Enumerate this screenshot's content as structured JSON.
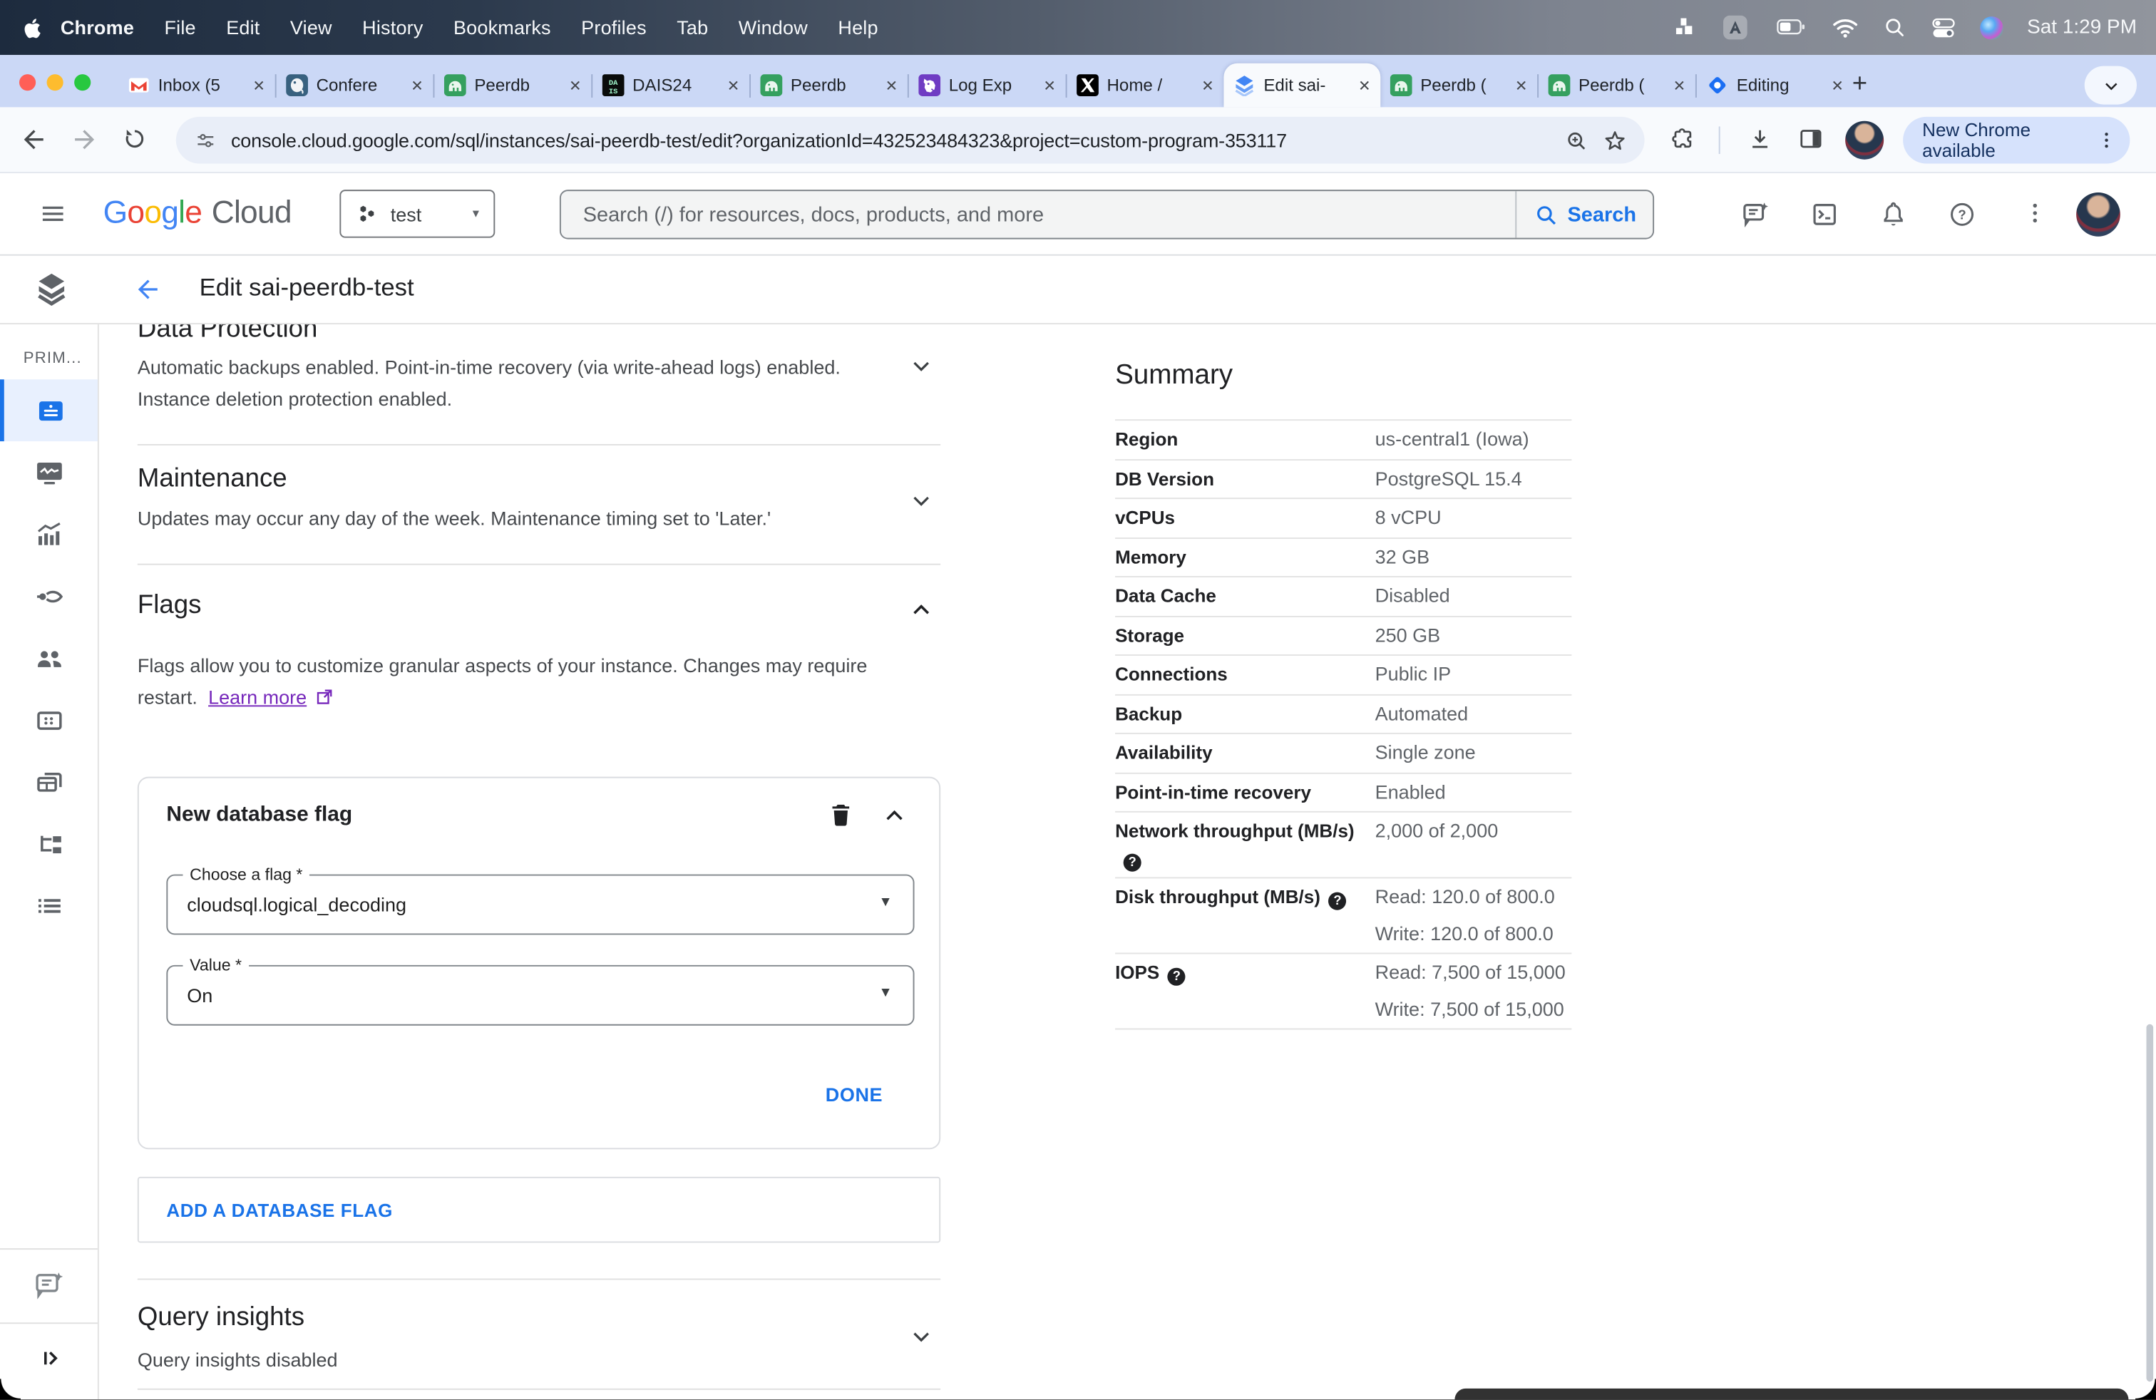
{
  "menu_bar": {
    "items": [
      "Chrome",
      "File",
      "Edit",
      "View",
      "History",
      "Bookmarks",
      "Profiles",
      "Tab",
      "Window",
      "Help"
    ],
    "clock": "Sat 1:29 PM"
  },
  "tab_strip": {
    "tabs": [
      {
        "label": "Inbox (5",
        "icon": "gmail"
      },
      {
        "label": "Confere",
        "icon": "postgres"
      },
      {
        "label": "Peerdb",
        "icon": "peerdb"
      },
      {
        "label": "DAIS24",
        "icon": "dais"
      },
      {
        "label": "Peerdb",
        "icon": "peerdb"
      },
      {
        "label": "Log Exp",
        "icon": "datadog"
      },
      {
        "label": "Home /",
        "icon": "x"
      },
      {
        "label": "Edit sai-",
        "icon": "cloudsql",
        "active": true
      },
      {
        "label": "Peerdb (",
        "icon": "peerdb"
      },
      {
        "label": "Peerdb (",
        "icon": "peerdb"
      },
      {
        "label": "Editing",
        "icon": "editing"
      }
    ],
    "new_tab": "+"
  },
  "toolbar": {
    "url": "console.cloud.google.com/sql/instances/sai-peerdb-test/edit?organizationId=432523484323&project=custom-program-353117",
    "update_pill": "New Chrome available"
  },
  "gcp_header": {
    "project": "test",
    "search_placeholder": "Search (/) for resources, docs, products, and more",
    "search_button": "Search"
  },
  "sidebar": {
    "section_label": "PRIM...",
    "items": [
      "overview",
      "system-insights",
      "query-insights",
      "connections",
      "users",
      "databases",
      "backups",
      "replicas",
      "operations"
    ]
  },
  "page": {
    "title": "Edit sai-peerdb-test"
  },
  "content": {
    "data_protection": {
      "title": "Data Protection",
      "line1": "Automatic backups enabled. Point-in-time recovery (via write-ahead logs) enabled.",
      "line2": "Instance deletion protection enabled."
    },
    "maintenance": {
      "title": "Maintenance",
      "description": "Updates may occur any day of the week. Maintenance timing set to 'Later.'"
    },
    "flags": {
      "title": "Flags",
      "line1": "Flags allow you to customize granular aspects of your instance. Changes may require",
      "line2_prefix": "restart.",
      "learn_more": "Learn more"
    },
    "flag_card": {
      "title": "New database flag",
      "choose_label": "Choose a flag *",
      "choose_value": "cloudsql.logical_decoding",
      "value_label": "Value *",
      "value_value": "On",
      "done": "DONE"
    },
    "add_flag_button": "ADD A DATABASE FLAG",
    "query_insights": {
      "title": "Query insights",
      "description": "Query insights disabled"
    }
  },
  "summary": {
    "title": "Summary",
    "rows": [
      {
        "label": "Region",
        "values": [
          "us-central1 (Iowa)"
        ]
      },
      {
        "label": "DB Version",
        "values": [
          "PostgreSQL 15.4"
        ]
      },
      {
        "label": "vCPUs",
        "values": [
          "8 vCPU"
        ]
      },
      {
        "label": "Memory",
        "values": [
          "32 GB"
        ]
      },
      {
        "label": "Data Cache",
        "values": [
          "Disabled"
        ]
      },
      {
        "label": "Storage",
        "values": [
          "250 GB"
        ]
      },
      {
        "label": "Connections",
        "values": [
          "Public IP"
        ]
      },
      {
        "label": "Backup",
        "values": [
          "Automated"
        ]
      },
      {
        "label": "Availability",
        "values": [
          "Single zone"
        ]
      },
      {
        "label": "Point-in-time recovery",
        "values": [
          "Enabled"
        ]
      },
      {
        "label": "Network throughput (MB/s)",
        "help": true,
        "values": [
          "2,000 of 2,000"
        ]
      },
      {
        "label": "Disk throughput (MB/s)",
        "help": true,
        "values": [
          "Read: 120.0 of 800.0",
          "Write: 120.0 of 800.0"
        ]
      },
      {
        "label": "IOPS",
        "help": true,
        "values": [
          "Read: 7,500 of 15,000",
          "Write: 7,500 of 15,000"
        ]
      }
    ]
  }
}
